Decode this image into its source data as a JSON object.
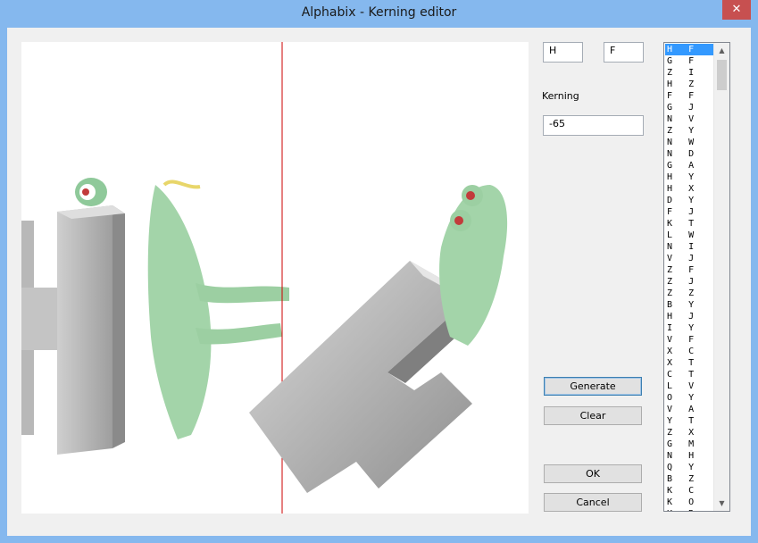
{
  "window": {
    "title": "Alphabix - Kerning editor",
    "close_glyph": "✕"
  },
  "inputs": {
    "left_char": "H",
    "right_char": "F",
    "kerning_label": "Kerning",
    "kerning_value": "-65"
  },
  "buttons": {
    "generate": "Generate",
    "clear": "Clear",
    "ok": "OK",
    "cancel": "Cancel"
  },
  "pairs": [
    [
      "H",
      "F"
    ],
    [
      "G",
      "F"
    ],
    [
      "Z",
      "I"
    ],
    [
      "H",
      "Z"
    ],
    [
      "F",
      "F"
    ],
    [
      "G",
      "J"
    ],
    [
      "N",
      "V"
    ],
    [
      "Z",
      "Y"
    ],
    [
      "N",
      "W"
    ],
    [
      "N",
      "D"
    ],
    [
      "G",
      "A"
    ],
    [
      "H",
      "Y"
    ],
    [
      "H",
      "X"
    ],
    [
      "D",
      "Y"
    ],
    [
      "F",
      "J"
    ],
    [
      "K",
      "T"
    ],
    [
      "L",
      "W"
    ],
    [
      "N",
      "I"
    ],
    [
      "V",
      "J"
    ],
    [
      "Z",
      "F"
    ],
    [
      "Z",
      "J"
    ],
    [
      "Z",
      "Z"
    ],
    [
      "B",
      "Y"
    ],
    [
      "H",
      "J"
    ],
    [
      "I",
      "Y"
    ],
    [
      "V",
      "F"
    ],
    [
      "X",
      "C"
    ],
    [
      "X",
      "T"
    ],
    [
      "C",
      "T"
    ],
    [
      "L",
      "V"
    ],
    [
      "O",
      "Y"
    ],
    [
      "V",
      "A"
    ],
    [
      "Y",
      "T"
    ],
    [
      "Z",
      "X"
    ],
    [
      "G",
      "M"
    ],
    [
      "N",
      "H"
    ],
    [
      "Q",
      "Y"
    ],
    [
      "B",
      "Z"
    ],
    [
      "K",
      "C"
    ],
    [
      "K",
      "O"
    ],
    [
      "K",
      "R"
    ]
  ],
  "scrollbar": {
    "up": "▲",
    "down": "▼"
  },
  "colors": {
    "selection": "#3399ff",
    "guide_line": "#cc0000",
    "titlebar": "#85b8ee"
  }
}
